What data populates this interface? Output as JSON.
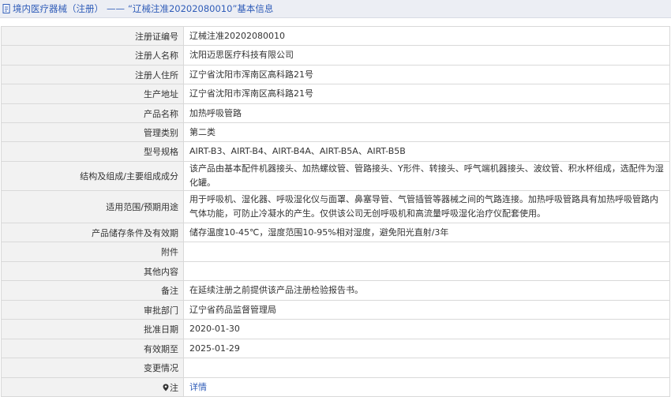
{
  "header": {
    "breadcrumb": "境内医疗器械（注册）",
    "separator": "——",
    "title": "“辽械注准20202080010”基本信息"
  },
  "rows": [
    {
      "label": "注册证编号",
      "value": "辽械注准20202080010"
    },
    {
      "label": "注册人名称",
      "value": "沈阳迈思医疗科技有限公司"
    },
    {
      "label": "注册人住所",
      "value": "辽宁省沈阳市浑南区高科路21号"
    },
    {
      "label": "生产地址",
      "value": "辽宁省沈阳市浑南区高科路21号"
    },
    {
      "label": "产品名称",
      "value": "加热呼吸管路"
    },
    {
      "label": "管理类别",
      "value": "第二类"
    },
    {
      "label": "型号规格",
      "value": "AIRT-B3、AIRT-B4、AIRT-B4A、AIRT-B5A、AIRT-B5B"
    },
    {
      "label": "结构及组成/主要组成成分",
      "value": "该产品由基本配件机器接头、加热螺纹管、管路接头、Y形件、转接头、呼气端机器接头、波纹管、积水杯组成，选配件为湿化罐。"
    },
    {
      "label": "适用范围/预期用途",
      "value": "用于呼吸机、湿化器、呼吸湿化仪与面罩、鼻塞导管、气管插管等器械之间的气路连接。加热呼吸管路具有加热呼吸管路内气体功能，可防止冷凝水的产生。仅供该公司无创呼吸机和高流量呼吸湿化治疗仪配套使用。"
    },
    {
      "label": "产品储存条件及有效期",
      "value": "储存温度10-45℃，湿度范围10-95%相对湿度，避免阳光直射/3年"
    },
    {
      "label": "附件",
      "value": ""
    },
    {
      "label": "其他内容",
      "value": ""
    },
    {
      "label": "备注",
      "value": "在延续注册之前提供该产品注册检验报告书。"
    },
    {
      "label": "审批部门",
      "value": "辽宁省药品监督管理局"
    },
    {
      "label": "批准日期",
      "value": "2020-01-30"
    },
    {
      "label": "有效期至",
      "value": "2025-01-29"
    },
    {
      "label": "变更情况",
      "value": ""
    }
  ],
  "note_row": {
    "label": "注",
    "link": "详情"
  },
  "colors": {
    "link": "#2f5cb8",
    "label_bg": "#f2f2f2",
    "border": "#d9d9d9",
    "header_bg": "#eceef4"
  }
}
